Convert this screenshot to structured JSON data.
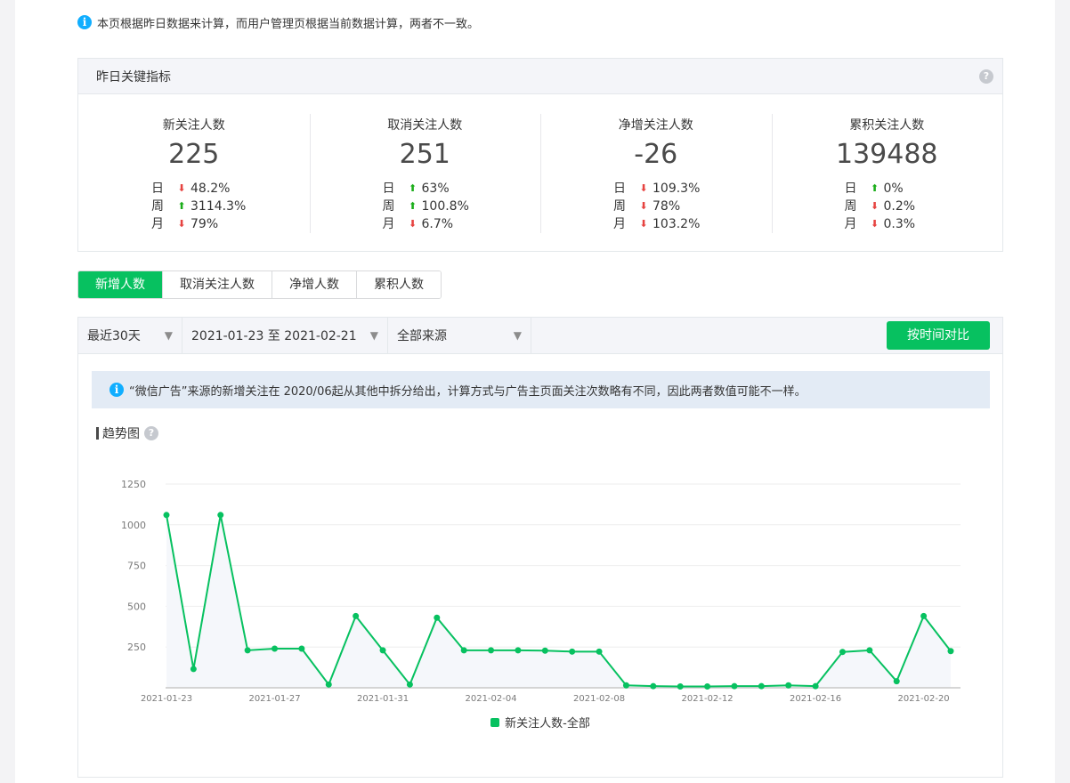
{
  "notice": "本页根据昨日数据来计算，而用户管理页根据当前数据计算，两者不一致。",
  "kpi_card": {
    "title": "昨日关键指标",
    "help": "?",
    "items": [
      {
        "label": "新关注人数",
        "value": "225",
        "rows": [
          {
            "period": "日",
            "dir": "down",
            "pct": "48.2%"
          },
          {
            "period": "周",
            "dir": "up",
            "pct": "3114.3%"
          },
          {
            "period": "月",
            "dir": "down",
            "pct": "79%"
          }
        ]
      },
      {
        "label": "取消关注人数",
        "value": "251",
        "rows": [
          {
            "period": "日",
            "dir": "up",
            "pct": "63%"
          },
          {
            "period": "周",
            "dir": "up",
            "pct": "100.8%"
          },
          {
            "period": "月",
            "dir": "down",
            "pct": "6.7%"
          }
        ]
      },
      {
        "label": "净增关注人数",
        "value": "-26",
        "rows": [
          {
            "period": "日",
            "dir": "down",
            "pct": "109.3%"
          },
          {
            "period": "周",
            "dir": "down",
            "pct": "78%"
          },
          {
            "period": "月",
            "dir": "down",
            "pct": "103.2%"
          }
        ]
      },
      {
        "label": "累积关注人数",
        "value": "139488",
        "rows": [
          {
            "period": "日",
            "dir": "up",
            "pct": "0%"
          },
          {
            "period": "周",
            "dir": "down",
            "pct": "0.2%"
          },
          {
            "period": "月",
            "dir": "down",
            "pct": "0.3%"
          }
        ]
      }
    ]
  },
  "tabs": [
    {
      "label": "新增人数",
      "active": true
    },
    {
      "label": "取消关注人数",
      "active": false
    },
    {
      "label": "净增人数",
      "active": false
    },
    {
      "label": "累积人数",
      "active": false
    }
  ],
  "toolbar": {
    "range": "最近30天",
    "dates": "2021-01-23 至 2021-02-21",
    "source": "全部来源",
    "compare_button": "按时间对比"
  },
  "tip": "“微信广告”来源的新增关注在 2020/06起从其他中拆分给出，计算方式与广告主页面关注次数略有不同，因此两者数值可能不一样。",
  "trend_title": "趋势图",
  "icons": {
    "info": "info-icon",
    "help": "help-icon",
    "caret": "caret-down-icon",
    "arrow_up": "arrow-up-icon",
    "arrow_down": "arrow-down-icon"
  },
  "colors": {
    "accent": "#07c160",
    "up": "#1aad19",
    "down": "#e64340",
    "info": "#10aeff"
  },
  "chart_data": {
    "type": "line",
    "x": [
      "2021-01-23",
      "2021-01-24",
      "2021-01-25",
      "2021-01-26",
      "2021-01-27",
      "2021-01-28",
      "2021-01-29",
      "2021-01-30",
      "2021-01-31",
      "2021-02-01",
      "2021-02-02",
      "2021-02-03",
      "2021-02-04",
      "2021-02-05",
      "2021-02-06",
      "2021-02-07",
      "2021-02-08",
      "2021-02-09",
      "2021-02-10",
      "2021-02-11",
      "2021-02-12",
      "2021-02-13",
      "2021-02-14",
      "2021-02-15",
      "2021-02-16",
      "2021-02-17",
      "2021-02-18",
      "2021-02-19",
      "2021-02-20",
      "2021-02-21"
    ],
    "x_tick_labels": [
      "2021-01-23",
      "2021-01-27",
      "2021-01-31",
      "2021-02-04",
      "2021-02-08",
      "2021-02-12",
      "2021-02-16",
      "2021-02-20"
    ],
    "series": [
      {
        "name": "新关注人数-全部",
        "values": [
          1060,
          115,
          1060,
          230,
          240,
          240,
          20,
          440,
          230,
          20,
          430,
          230,
          230,
          230,
          228,
          222,
          222,
          15,
          10,
          8,
          8,
          10,
          10,
          15,
          10,
          220,
          230,
          40,
          440,
          225
        ]
      }
    ],
    "ylim": [
      0,
      1250
    ],
    "yticks": [
      250,
      500,
      750,
      1000,
      1250
    ],
    "grid": true,
    "legend": "bottom-center"
  }
}
